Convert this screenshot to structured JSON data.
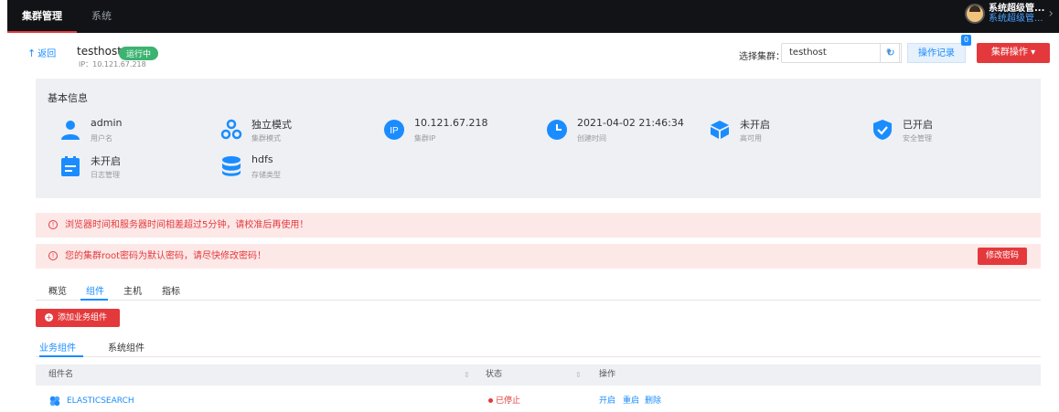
{
  "nav": {
    "items": [
      "集群管理",
      "系统"
    ],
    "user_name": "系统超级管...",
    "user_sub": "系统超级管..."
  },
  "header": {
    "back_label": "返回",
    "host_name": "testhost",
    "status": "运行中",
    "ip_text": "IP：10.121.67.218",
    "select_label": "选择集群：",
    "select_value": "testhost",
    "oplog_label": "操作记录",
    "oplog_badge": "0",
    "cluster_op_label": "集群操作"
  },
  "info": {
    "title": "基本信息",
    "items": [
      {
        "value": "admin",
        "label": "用户名",
        "icon": "user-icon"
      },
      {
        "value": "独立模式",
        "label": "集群模式",
        "icon": "cluster-mode-icon"
      },
      {
        "value": "10.121.67.218",
        "label": "集群IP",
        "icon": "ip-icon"
      },
      {
        "value": "2021-04-02 21:46:34",
        "label": "创建时间",
        "icon": "clock-icon"
      },
      {
        "value": "未开启",
        "label": "高可用",
        "icon": "cube-icon"
      },
      {
        "value": "已开启",
        "label": "安全管理",
        "icon": "shield-icon"
      },
      {
        "value": "未开启",
        "label": "日志管理",
        "icon": "log-icon"
      },
      {
        "value": "hdfs",
        "label": "存储类型",
        "icon": "database-icon"
      }
    ]
  },
  "alerts": [
    {
      "text": "浏览器时间和服务器时间相差超过5分钟，请校准后再使用！"
    },
    {
      "text": "您的集群root密码为默认密码，请尽快修改密码！",
      "button": "修改密码"
    }
  ],
  "tabs": [
    "概览",
    "组件",
    "主机",
    "指标"
  ],
  "add_button": "添加业务组件",
  "subtabs": [
    "业务组件",
    "系统组件"
  ],
  "table": {
    "headers": [
      "组件名",
      "状态",
      "操作"
    ],
    "rows": [
      {
        "name": "ELASTICSEARCH",
        "status": "已停止",
        "actions": [
          "开启",
          "重启",
          "删除"
        ]
      }
    ]
  },
  "colors": {
    "accent": "#1a8cff",
    "danger": "#e4393c",
    "success": "#3cb371"
  }
}
